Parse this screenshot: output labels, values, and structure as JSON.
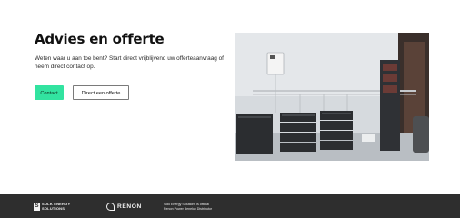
{
  "hero": {
    "title": "Advies en offerte",
    "lead": "Weten waar u aan toe bent? Start direct vrijblijvend uw offerteaanvraag of neem direct contact op.",
    "buttons": {
      "primary_label": "Contact",
      "secondary_label": "Direct een offerte"
    },
    "image_alt": "Battery storage installation"
  },
  "footer": {
    "solk_logo_text": "SOLK ENERGY\nSOLUTIONS",
    "renon_logo_text": "RENON",
    "note": "Solk Energy Solutions is official\nRenon Power Benelux Distributor"
  },
  "colors": {
    "accent": "#32e3a0",
    "footer_bg": "#2e2e2e"
  }
}
